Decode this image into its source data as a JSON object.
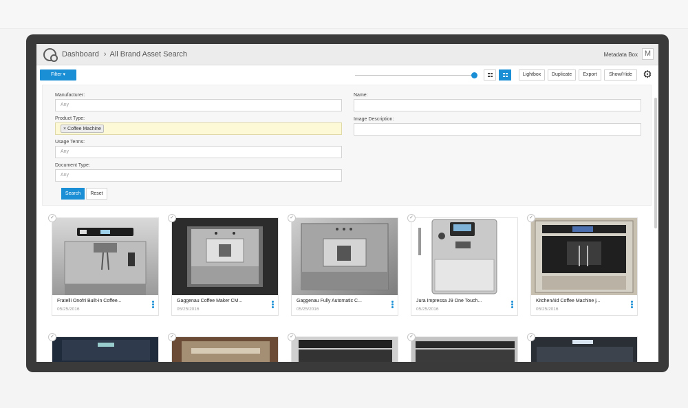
{
  "header": {
    "breadcrumb": [
      "Dashboard",
      "All Brand Asset Search"
    ],
    "crumb_separator": "›",
    "metadata_label": "Metadata Box",
    "metadata_btn": "M"
  },
  "toolbar": {
    "filter_label": "Filter ▾",
    "slider_value": 1.0,
    "buttons": [
      "Lightbox",
      "Duplicate",
      "Export",
      "Show/Hide"
    ],
    "gear": "⚙"
  },
  "filters": {
    "manufacturer": {
      "label": "Manufacturer:",
      "placeholder": "Any"
    },
    "product_type": {
      "label": "Product Type:",
      "tag": "× Coffee Machine"
    },
    "usage_terms": {
      "label": "Usage Terms:",
      "placeholder": "Any"
    },
    "document_type": {
      "label": "Document Type:",
      "placeholder": "Any"
    },
    "name": {
      "label": "Name:",
      "value": ""
    },
    "image_description": {
      "label": "Image Description:",
      "value": ""
    },
    "search_label": "Search",
    "reset_label": "Reset"
  },
  "results": [
    {
      "title": "Fratelli Onofri Built-in Coffee...",
      "date": "05/25/2016",
      "theme": "silver"
    },
    {
      "title": "Gaggenau Coffee Maker CM...",
      "date": "05/25/2016",
      "theme": "dark"
    },
    {
      "title": "Gaggenau Fully Automatic C...",
      "date": "05/25/2016",
      "theme": "steel"
    },
    {
      "title": "Jura Impressa J9 One Touch...",
      "date": "05/25/2016",
      "theme": "jura"
    },
    {
      "title": "KitchenAid Coffee Machine j...",
      "date": "05/25/2016",
      "theme": "kitchenaid"
    }
  ],
  "check_glyph": "✓"
}
